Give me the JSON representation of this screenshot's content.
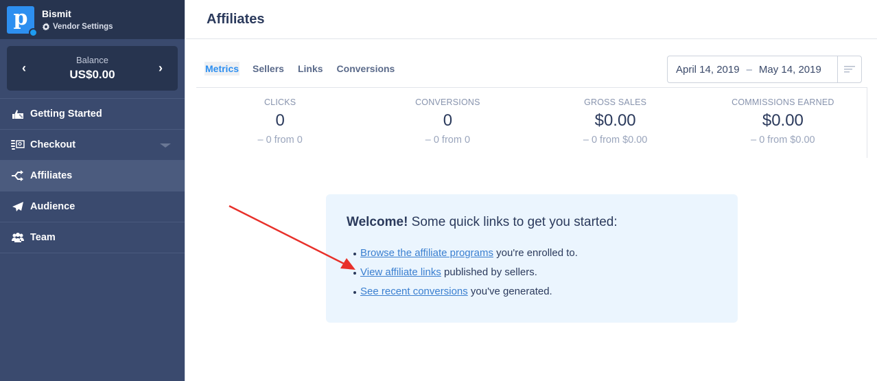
{
  "sidebar": {
    "brand": {
      "logo_letter": "p",
      "name": "Bismit",
      "vendor_settings_label": "Vendor Settings"
    },
    "balance": {
      "label": "Balance",
      "value": "US$0.00",
      "prev_icon": "‹",
      "next_icon": "›"
    },
    "items": [
      {
        "label": "Getting Started",
        "icon": "getting-started-icon"
      },
      {
        "label": "Checkout",
        "icon": "checkout-icon",
        "has_dropdown": true
      },
      {
        "label": "Affiliates",
        "icon": "affiliates-icon",
        "active": true
      },
      {
        "label": "Audience",
        "icon": "paper-plane-icon"
      },
      {
        "label": "Team",
        "icon": "team-icon"
      }
    ]
  },
  "header": {
    "title": "Affiliates"
  },
  "tabs": [
    {
      "label": "Metrics",
      "active": true
    },
    {
      "label": "Sellers"
    },
    {
      "label": "Links"
    },
    {
      "label": "Conversions"
    }
  ],
  "date_range": {
    "start": "April 14, 2019",
    "separator": "–",
    "end": "May 14, 2019"
  },
  "metrics": [
    {
      "label": "CLICKS",
      "value": "0",
      "delta": "– 0 from 0"
    },
    {
      "label": "CONVERSIONS",
      "value": "0",
      "delta": "– 0 from 0"
    },
    {
      "label": "GROSS SALES",
      "value": "$0.00",
      "delta": "– 0 from $0.00"
    },
    {
      "label": "COMMISSIONS EARNED",
      "value": "$0.00",
      "delta": "– 0 from $0.00"
    }
  ],
  "welcome": {
    "title_bold": "Welcome!",
    "title_rest": " Some quick links to get you started:",
    "links": [
      {
        "link_text": "Browse the affiliate programs",
        "rest": " you're enrolled to."
      },
      {
        "link_text": "View affiliate links",
        "rest": " published by sellers."
      },
      {
        "link_text": "See recent conversions",
        "rest": " you've generated."
      }
    ]
  },
  "annotation": {
    "arrow_color": "#e8302a",
    "points_to": "View affiliate links"
  },
  "colors": {
    "sidebar_bg": "#3a4a6e",
    "sidebar_dark": "#27344f",
    "accent": "#2d8ff0",
    "welcome_bg": "#ebf5fe",
    "link": "#3a7fd0"
  }
}
